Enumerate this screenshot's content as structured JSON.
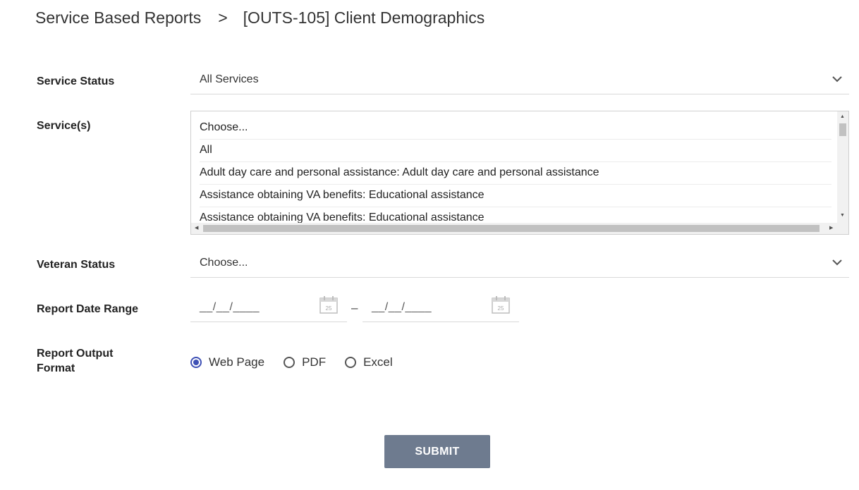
{
  "breadcrumb": {
    "parent": "Service Based Reports",
    "separator": ">",
    "current": "[OUTS-105] Client Demographics"
  },
  "service_status": {
    "label": "Service Status",
    "value": "All Services"
  },
  "services": {
    "label": "Service(s)",
    "options": [
      "Choose...",
      "All",
      "Adult day care and personal assistance: Adult day care and personal assistance",
      "Assistance obtaining VA benefits: Educational assistance",
      "Assistance obtaining VA benefits: Educational assistance"
    ]
  },
  "veteran_status": {
    "label": "Veteran Status",
    "value": "Choose..."
  },
  "date_range": {
    "label": "Report Date Range",
    "start": "__/__/____",
    "separator": "–",
    "end": "__/__/____",
    "calendar_day": "25"
  },
  "output_format": {
    "label_line1": "Report Output",
    "label_line2": "Format",
    "options": [
      "Web Page",
      "PDF",
      "Excel"
    ],
    "selected": "Web Page"
  },
  "submit_label": "SUBMIT",
  "colors": {
    "accent": "#3f51b5",
    "submit_bg": "#6e7b8f"
  }
}
